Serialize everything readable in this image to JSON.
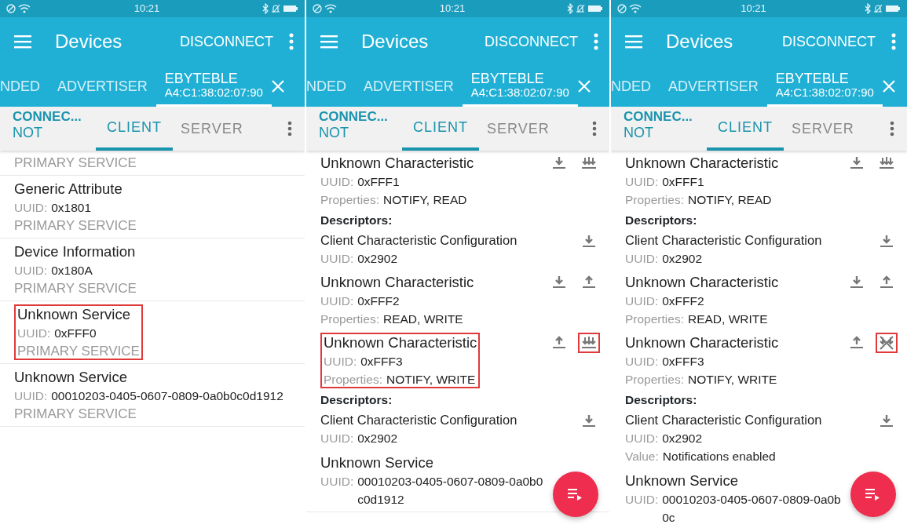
{
  "panels": [
    {
      "status_bar": {
        "time": "10:21"
      },
      "app_bar": {
        "title": "Devices",
        "action": "DISCONNECT"
      },
      "device_tabs": [
        {
          "label": "NDED",
          "selected": false
        },
        {
          "label": "ADVERTISER",
          "selected": false
        },
        {
          "label": "EBYTEBLE",
          "address": "A4:C1:38:02:07:90",
          "selected": true,
          "closable": true
        }
      ],
      "connection": {
        "state": "CONNEC...",
        "bond": "NOT"
      },
      "view_tabs": [
        {
          "label": "CLIENT",
          "selected": true
        },
        {
          "label": "SERVER",
          "selected": false
        }
      ],
      "items": [
        {
          "kind": "service",
          "highlighted": false,
          "type": "PRIMARY SERVICE"
        },
        {
          "kind": "service",
          "highlighted": false,
          "title": "Generic Attribute",
          "fields": [
            {
              "label": "UUID:",
              "value": "0x1801"
            }
          ],
          "type": "PRIMARY SERVICE"
        },
        {
          "kind": "service",
          "highlighted": false,
          "title": "Device Information",
          "fields": [
            {
              "label": "UUID:",
              "value": "0x180A"
            }
          ],
          "type": "PRIMARY SERVICE"
        },
        {
          "kind": "service",
          "highlighted": true,
          "title": "Unknown Service",
          "fields": [
            {
              "label": "UUID:",
              "value": "0xFFF0"
            }
          ],
          "type": "PRIMARY SERVICE"
        },
        {
          "kind": "service",
          "highlighted": false,
          "title": "Unknown Service",
          "fields": [
            {
              "label": "UUID:",
              "value": "00010203-0405-0607-0809-0a0b0c0d1912"
            }
          ],
          "type": "PRIMARY SERVICE"
        }
      ]
    },
    {
      "status_bar": {
        "time": "10:21"
      },
      "app_bar": {
        "title": "Devices",
        "action": "DISCONNECT"
      },
      "device_tabs": [
        {
          "label": "NDED",
          "selected": false
        },
        {
          "label": "ADVERTISER",
          "selected": false
        },
        {
          "label": "EBYTEBLE",
          "address": "A4:C1:38:02:07:90",
          "selected": true,
          "closable": true
        }
      ],
      "connection": {
        "state": "CONNEC...",
        "bond": "NOT"
      },
      "view_tabs": [
        {
          "label": "CLIENT",
          "selected": true
        },
        {
          "label": "SERVER",
          "selected": false
        }
      ],
      "items": [
        {
          "kind": "characteristic",
          "highlighted": false,
          "title": "Unknown Characteristic",
          "fields": [
            {
              "label": "UUID:",
              "value": "0xFFF1"
            },
            {
              "label": "Properties:",
              "value": "NOTIFY, READ"
            }
          ],
          "actions": [
            {
              "kind": "read",
              "highlighted": false
            },
            {
              "kind": "notify",
              "highlighted": false
            }
          ]
        },
        {
          "kind": "descriptors_header",
          "text": "Descriptors:"
        },
        {
          "kind": "descriptor",
          "highlighted": false,
          "title": "Client Characteristic Configuration",
          "fields": [
            {
              "label": "UUID:",
              "value": "0x2902"
            }
          ],
          "actions": [
            {
              "kind": "read",
              "highlighted": false
            }
          ]
        },
        {
          "kind": "characteristic",
          "highlighted": false,
          "title": "Unknown Characteristic",
          "fields": [
            {
              "label": "UUID:",
              "value": "0xFFF2"
            },
            {
              "label": "Properties:",
              "value": "READ, WRITE"
            }
          ],
          "actions": [
            {
              "kind": "read",
              "highlighted": false
            },
            {
              "kind": "write",
              "highlighted": false
            }
          ]
        },
        {
          "kind": "characteristic",
          "highlighted": true,
          "title": "Unknown Characteristic",
          "fields": [
            {
              "label": "UUID:",
              "value": "0xFFF3"
            },
            {
              "label": "Properties:",
              "value": "NOTIFY, WRITE"
            }
          ],
          "actions": [
            {
              "kind": "write",
              "highlighted": false
            },
            {
              "kind": "notify",
              "highlighted": true
            }
          ]
        },
        {
          "kind": "descriptors_header",
          "text": "Descriptors:"
        },
        {
          "kind": "descriptor",
          "highlighted": false,
          "title": "Client Characteristic Configuration",
          "fields": [
            {
              "label": "UUID:",
              "value": "0x2902"
            }
          ],
          "actions": [
            {
              "kind": "read",
              "highlighted": false
            }
          ]
        },
        {
          "kind": "service",
          "highlighted": false,
          "title": "Unknown Service",
          "fields": [
            {
              "label": "UUID:",
              "value": "00010203-0405-0607-0809-0a0b0c0d1912"
            }
          ]
        }
      ],
      "fab": true
    },
    {
      "status_bar": {
        "time": "10:21"
      },
      "app_bar": {
        "title": "Devices",
        "action": "DISCONNECT"
      },
      "device_tabs": [
        {
          "label": "NDED",
          "selected": false
        },
        {
          "label": "ADVERTISER",
          "selected": false
        },
        {
          "label": "EBYTEBLE",
          "address": "A4:C1:38:02:07:90",
          "selected": true,
          "closable": true
        }
      ],
      "connection": {
        "state": "CONNEC...",
        "bond": "NOT"
      },
      "view_tabs": [
        {
          "label": "CLIENT",
          "selected": true
        },
        {
          "label": "SERVER",
          "selected": false
        }
      ],
      "items": [
        {
          "kind": "characteristic",
          "highlighted": false,
          "title": "Unknown Characteristic",
          "fields": [
            {
              "label": "UUID:",
              "value": "0xFFF1"
            },
            {
              "label": "Properties:",
              "value": "NOTIFY, READ"
            }
          ],
          "actions": [
            {
              "kind": "read",
              "highlighted": false
            },
            {
              "kind": "notify",
              "highlighted": false
            }
          ]
        },
        {
          "kind": "descriptors_header",
          "text": "Descriptors:"
        },
        {
          "kind": "descriptor",
          "highlighted": false,
          "title": "Client Characteristic Configuration",
          "fields": [
            {
              "label": "UUID:",
              "value": "0x2902"
            }
          ],
          "actions": [
            {
              "kind": "read",
              "highlighted": false
            }
          ]
        },
        {
          "kind": "characteristic",
          "highlighted": false,
          "title": "Unknown Characteristic",
          "fields": [
            {
              "label": "UUID:",
              "value": "0xFFF2"
            },
            {
              "label": "Properties:",
              "value": "READ, WRITE"
            }
          ],
          "actions": [
            {
              "kind": "read",
              "highlighted": false
            },
            {
              "kind": "write",
              "highlighted": false
            }
          ]
        },
        {
          "kind": "characteristic",
          "highlighted": false,
          "title": "Unknown Characteristic",
          "fields": [
            {
              "label": "UUID:",
              "value": "0xFFF3"
            },
            {
              "label": "Properties:",
              "value": "NOTIFY, WRITE"
            }
          ],
          "actions": [
            {
              "kind": "write",
              "highlighted": false
            },
            {
              "kind": "notify_off",
              "highlighted": true
            }
          ]
        },
        {
          "kind": "descriptors_header",
          "text": "Descriptors:"
        },
        {
          "kind": "descriptor",
          "highlighted": false,
          "title": "Client Characteristic Configuration",
          "fields": [
            {
              "label": "UUID:",
              "value": "0x2902"
            },
            {
              "label": "Value:",
              "value": "Notifications enabled"
            }
          ],
          "actions": [
            {
              "kind": "read",
              "highlighted": false
            }
          ]
        },
        {
          "kind": "service",
          "highlighted": false,
          "title": "Unknown Service",
          "fields": [
            {
              "label": "UUID:",
              "value": "00010203-0405-0607-0809-0a0b0c"
            }
          ]
        }
      ],
      "fab": true
    }
  ]
}
